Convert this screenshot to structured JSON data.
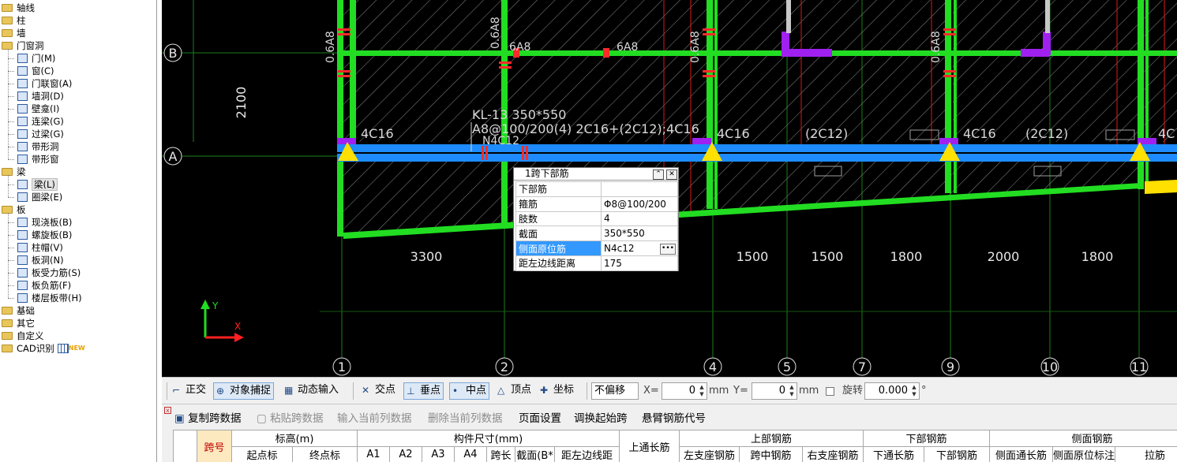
{
  "sidebar": {
    "items": [
      {
        "label": "轴线",
        "level": 0,
        "icon": "folder-icon"
      },
      {
        "label": "柱",
        "level": 0,
        "icon": "folder-icon"
      },
      {
        "label": "墙",
        "level": 0,
        "icon": "folder-icon"
      },
      {
        "label": "门窗洞",
        "level": 0,
        "icon": "folder-open-icon"
      },
      {
        "label": "门(M)",
        "level": 1,
        "icon": "door-icon"
      },
      {
        "label": "窗(C)",
        "level": 1,
        "icon": "window-icon"
      },
      {
        "label": "门联窗(A)",
        "level": 1,
        "icon": "door-window-icon"
      },
      {
        "label": "墙洞(D)",
        "level": 1,
        "icon": "wall-hole-icon"
      },
      {
        "label": "壁龛(I)",
        "level": 1,
        "icon": "niche-icon"
      },
      {
        "label": "连梁(G)",
        "level": 1,
        "icon": "link-beam-icon"
      },
      {
        "label": "过梁(G)",
        "level": 1,
        "icon": "lintel-icon"
      },
      {
        "label": "带形洞",
        "level": 1,
        "icon": "strip-hole-icon"
      },
      {
        "label": "带形窗",
        "level": 1,
        "icon": "strip-window-icon"
      },
      {
        "label": "梁",
        "level": 0,
        "icon": "folder-open-icon"
      },
      {
        "label": "梁(L)",
        "level": 1,
        "icon": "beam-icon",
        "selected": true
      },
      {
        "label": "圈梁(E)",
        "level": 1,
        "icon": "ring-beam-icon"
      },
      {
        "label": "板",
        "level": 0,
        "icon": "folder-open-icon"
      },
      {
        "label": "现浇板(B)",
        "level": 1,
        "icon": "cast-slab-icon"
      },
      {
        "label": "螺旋板(B)",
        "level": 1,
        "icon": "spiral-slab-icon"
      },
      {
        "label": "柱帽(V)",
        "level": 1,
        "icon": "column-cap-icon"
      },
      {
        "label": "板洞(N)",
        "level": 1,
        "icon": "slab-hole-icon"
      },
      {
        "label": "板受力筋(S)",
        "level": 1,
        "icon": "slab-rebar-icon"
      },
      {
        "label": "板负筋(F)",
        "level": 1,
        "icon": "slab-neg-rebar-icon"
      },
      {
        "label": "楼层板带(H)",
        "level": 1,
        "icon": "floor-strip-icon"
      },
      {
        "label": "基础",
        "level": 0,
        "icon": "folder-icon"
      },
      {
        "label": "其它",
        "level": 0,
        "icon": "folder-icon"
      },
      {
        "label": "自定义",
        "level": 0,
        "icon": "folder-icon"
      },
      {
        "label": "CAD识别",
        "level": 0,
        "icon": "folder-icon",
        "badge": "NEW"
      }
    ]
  },
  "canvas": {
    "axis_rows": [
      "B",
      "A"
    ],
    "axis_cols": [
      "1",
      "2",
      "4",
      "5",
      "7",
      "9",
      "10",
      "11"
    ],
    "dim_vertical": "2100",
    "dims_bottom": [
      "3300",
      "1500",
      "1500",
      "1800",
      "2000",
      "1800"
    ],
    "beam_label_1": "KL-13 350*550",
    "beam_label_2": "A8@100/200(4) 2C16+(2C12);4C16",
    "beam_label_3": "N4C12",
    "rebar_labels": [
      "4C16",
      "4C16",
      "(2C12)",
      "4C16",
      "(2C12)",
      "4C"
    ],
    "stirrup_labels": [
      "0.6A8",
      "0.6A8",
      "0.6A8",
      "0.6A8",
      "6A8",
      "6A8"
    ],
    "colors": {
      "beam_green": "#22dd22",
      "beam_blue": "#1e8cff",
      "axis_red": "#ff2020",
      "magenta": "#a020f0",
      "support_yellow": "#ffe000"
    }
  },
  "prop_panel": {
    "title": "1跨下部筋",
    "rows": [
      {
        "key": "下部筋",
        "value": ""
      },
      {
        "key": "箍筋",
        "value": "Φ8@100/200"
      },
      {
        "key": "肢数",
        "value": "4"
      },
      {
        "key": "截面",
        "value": "350*550"
      },
      {
        "key": "侧面原位筋",
        "value": "N4c12"
      },
      {
        "key": "距左边线距离",
        "value": "175"
      }
    ]
  },
  "toolbar": {
    "ortho": "正交",
    "snap": "对象捕捉",
    "dynamic_input": "动态输入",
    "intersection": "交点",
    "perpendicular": "垂点",
    "midpoint": "中点",
    "vertex": "顶点",
    "coordinate": "坐标",
    "offset_mode": "不偏移",
    "x_label": "X=",
    "x_value": "0",
    "mm1": "mm",
    "y_label": "Y=",
    "y_value": "0",
    "mm2": "mm",
    "rotate_label": "旋转",
    "rotate_value": "0.000",
    "degree": "°"
  },
  "bottom_toolbar": {
    "copy_span": "复制跨数据",
    "paste_span": "粘贴跨数据",
    "input_col": "输入当前列数据",
    "delete_col": "删除当前列数据",
    "page_setup": "页面设置",
    "swap_start": "调换起始跨",
    "cantilever": "悬臂钢筋代号"
  },
  "grid": {
    "span_no": "跨号",
    "elevation": "标高(m)",
    "start_elev": "起点标",
    "end_elev": "终点标",
    "member_size": "构件尺寸(mm)",
    "a1": "A1",
    "a2": "A2",
    "a3": "A3",
    "a4": "A4",
    "span_len": "跨长",
    "section": "截面(B*",
    "left_dist": "距左边线距",
    "top_through": "上通长筋",
    "top_rebar": "上部钢筋",
    "left_support": "左支座钢筋",
    "mid_span": "跨中钢筋",
    "right_support": "右支座钢筋",
    "bottom_rebar": "下部钢筋",
    "bottom_through": "下通长筋",
    "bottom_bar": "下部钢筋",
    "side_rebar": "侧面钢筋",
    "side_through": "侧面通长筋",
    "side_inplace": "侧面原位标注",
    "tie": "拉筋"
  }
}
